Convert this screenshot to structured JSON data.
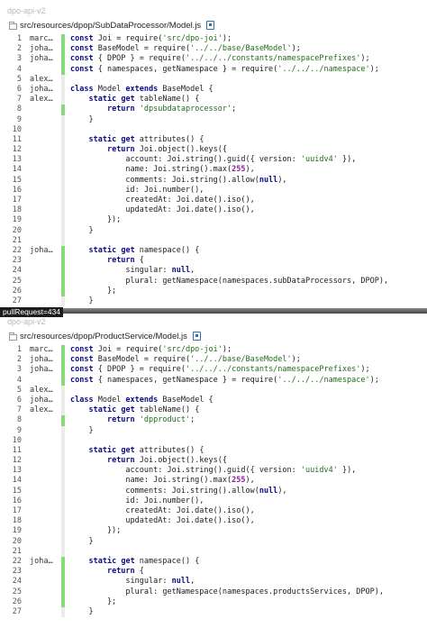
{
  "panes": [
    {
      "repo": "dpo-api-v2",
      "path": "src/resources/dpop/SubDataProcessor/Model.js",
      "lines": [
        {
          "n": "1",
          "blame": "marc…",
          "added": true,
          "code": "const Joi = require('src/dpo-joi');"
        },
        {
          "n": "2",
          "blame": "joha…",
          "added": true,
          "code": "const BaseModel = require('../../base/BaseModel');"
        },
        {
          "n": "3",
          "blame": "joha…",
          "added": true,
          "code": "const { DPOP } = require('../../../constants/namespacePrefixes');"
        },
        {
          "n": "4",
          "blame": "",
          "added": true,
          "code": "const { namespaces, getNamespace } = require('../../../namespace');"
        },
        {
          "n": "5",
          "blame": "alex…",
          "added": false,
          "code": ""
        },
        {
          "n": "6",
          "blame": "joha…",
          "added": false,
          "code": "class Model extends BaseModel {"
        },
        {
          "n": "7",
          "blame": "alex…",
          "added": false,
          "code": "    static get tableName() {"
        },
        {
          "n": "8",
          "blame": "",
          "added": true,
          "code": "        return 'dpsubdataprocessor';"
        },
        {
          "n": "9",
          "blame": "",
          "added": false,
          "code": "    }"
        },
        {
          "n": "10",
          "blame": "",
          "added": false,
          "code": ""
        },
        {
          "n": "11",
          "blame": "",
          "added": false,
          "code": "    static get attributes() {"
        },
        {
          "n": "12",
          "blame": "",
          "added": false,
          "code": "        return Joi.object().keys({"
        },
        {
          "n": "13",
          "blame": "",
          "added": false,
          "code": "            account: Joi.string().guid({ version: 'uuidv4' }),"
        },
        {
          "n": "14",
          "blame": "",
          "added": false,
          "code": "            name: Joi.string().max(255),"
        },
        {
          "n": "15",
          "blame": "",
          "added": false,
          "code": "            comments: Joi.string().allow(null),"
        },
        {
          "n": "16",
          "blame": "",
          "added": false,
          "code": "            id: Joi.number(),"
        },
        {
          "n": "17",
          "blame": "",
          "added": false,
          "code": "            createdAt: Joi.date().iso(),"
        },
        {
          "n": "18",
          "blame": "",
          "added": false,
          "code": "            updatedAt: Joi.date().iso(),"
        },
        {
          "n": "19",
          "blame": "",
          "added": false,
          "code": "        });"
        },
        {
          "n": "20",
          "blame": "",
          "added": false,
          "code": "    }"
        },
        {
          "n": "21",
          "blame": "",
          "added": false,
          "code": ""
        },
        {
          "n": "22",
          "blame": "joha…",
          "added": true,
          "code": "    static get namespace() {"
        },
        {
          "n": "23",
          "blame": "",
          "added": true,
          "code": "        return {"
        },
        {
          "n": "24",
          "blame": "",
          "added": true,
          "code": "            singular: null,"
        },
        {
          "n": "25",
          "blame": "",
          "added": true,
          "code": "            plural: getNamespace(namespaces.subDataProcessors, DPOP),"
        },
        {
          "n": "26",
          "blame": "",
          "added": true,
          "code": "        };"
        },
        {
          "n": "27",
          "blame": "",
          "added": false,
          "code": "    }"
        }
      ]
    },
    {
      "repo": "dpo-api-v2",
      "path": "src/resources/dpop/ProductService/Model.js",
      "lines": [
        {
          "n": "1",
          "blame": "marc…",
          "added": true,
          "code": "const Joi = require('src/dpo-joi');"
        },
        {
          "n": "2",
          "blame": "joha…",
          "added": true,
          "code": "const BaseModel = require('../../base/BaseModel');"
        },
        {
          "n": "3",
          "blame": "joha…",
          "added": true,
          "code": "const { DPOP } = require('../../../constants/namespacePrefixes');"
        },
        {
          "n": "4",
          "blame": "",
          "added": true,
          "code": "const { namespaces, getNamespace } = require('../../../namespace');"
        },
        {
          "n": "5",
          "blame": "alex…",
          "added": false,
          "code": ""
        },
        {
          "n": "6",
          "blame": "joha…",
          "added": false,
          "code": "class Model extends BaseModel {"
        },
        {
          "n": "7",
          "blame": "alex…",
          "added": false,
          "code": "    static get tableName() {"
        },
        {
          "n": "8",
          "blame": "",
          "added": true,
          "code": "        return 'dpproduct';"
        },
        {
          "n": "9",
          "blame": "",
          "added": false,
          "code": "    }"
        },
        {
          "n": "10",
          "blame": "",
          "added": false,
          "code": ""
        },
        {
          "n": "11",
          "blame": "",
          "added": false,
          "code": "    static get attributes() {"
        },
        {
          "n": "12",
          "blame": "",
          "added": false,
          "code": "        return Joi.object().keys({"
        },
        {
          "n": "13",
          "blame": "",
          "added": false,
          "code": "            account: Joi.string().guid({ version: 'uuidv4' }),"
        },
        {
          "n": "14",
          "blame": "",
          "added": false,
          "code": "            name: Joi.string().max(255),"
        },
        {
          "n": "15",
          "blame": "",
          "added": false,
          "code": "            comments: Joi.string().allow(null),"
        },
        {
          "n": "16",
          "blame": "",
          "added": false,
          "code": "            id: Joi.number(),"
        },
        {
          "n": "17",
          "blame": "",
          "added": false,
          "code": "            createdAt: Joi.date().iso(),"
        },
        {
          "n": "18",
          "blame": "",
          "added": false,
          "code": "            updatedAt: Joi.date().iso(),"
        },
        {
          "n": "19",
          "blame": "",
          "added": false,
          "code": "        });"
        },
        {
          "n": "20",
          "blame": "",
          "added": false,
          "code": "    }"
        },
        {
          "n": "21",
          "blame": "",
          "added": false,
          "code": ""
        },
        {
          "n": "22",
          "blame": "joha…",
          "added": true,
          "code": "    static get namespace() {"
        },
        {
          "n": "23",
          "blame": "",
          "added": true,
          "code": "        return {"
        },
        {
          "n": "24",
          "blame": "",
          "added": true,
          "code": "            singular: null,"
        },
        {
          "n": "25",
          "blame": "",
          "added": true,
          "code": "            plural: getNamespace(namespaces.productsServices, DPOP),"
        },
        {
          "n": "26",
          "blame": "",
          "added": true,
          "code": "        };"
        },
        {
          "n": "27",
          "blame": "",
          "added": false,
          "code": "    }"
        }
      ]
    }
  ],
  "overlay_label": "pullRequest=434",
  "colors": {
    "added_gutter": "#87d97a",
    "keyword": "#0a0a88",
    "string": "#236c1c",
    "number": "#8a1f98"
  }
}
